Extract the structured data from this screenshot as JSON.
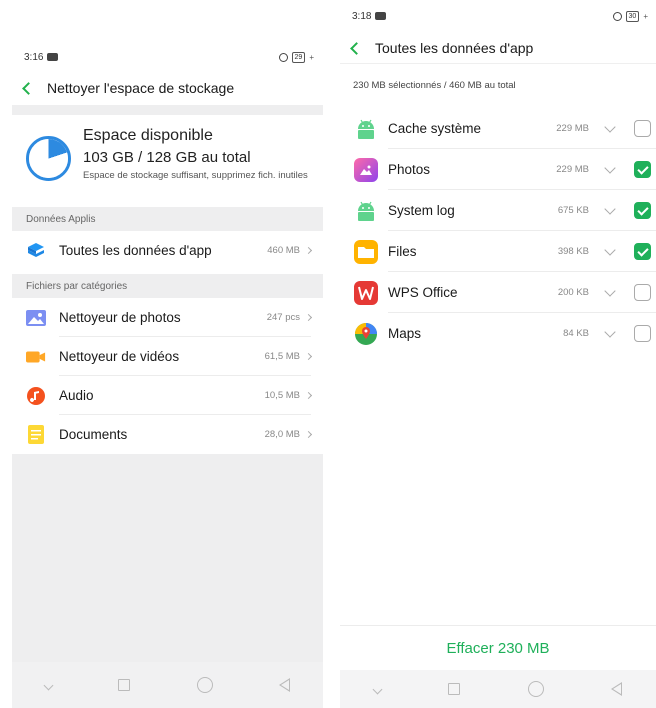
{
  "left": {
    "status": {
      "time": "3:16",
      "battery": "29"
    },
    "header": {
      "title": "Nettoyer l'espace de stockage"
    },
    "storage": {
      "title": "Espace disponible",
      "amount": "103 GB / 128 GB au total",
      "note": "Espace de stockage suffisant, supprimez fich. inutiles",
      "used_fraction": 0.2
    },
    "sections": {
      "apps": "Données Applis",
      "categories": "Fichiers par catégories"
    },
    "app_row": {
      "label": "Toutes les données d'app",
      "value": "460 MB"
    },
    "category_rows": [
      {
        "label": "Nettoyeur de photos",
        "value": "247 pcs",
        "icon": "photo-icon"
      },
      {
        "label": "Nettoyeur de vidéos",
        "value": "61,5 MB",
        "icon": "video-icon"
      },
      {
        "label": "Audio",
        "value": "10,5 MB",
        "icon": "audio-icon"
      },
      {
        "label": "Documents",
        "value": "28,0 MB",
        "icon": "document-icon"
      }
    ]
  },
  "right": {
    "status": {
      "time": "3:18",
      "battery": "30"
    },
    "header": {
      "title": "Toutes les données d'app"
    },
    "selection_summary": "230 MB sélectionnés / 460 MB au total",
    "apps": [
      {
        "name": "Cache système",
        "size": "229 MB",
        "checked": false,
        "icon": "android-icon"
      },
      {
        "name": "Photos",
        "size": "229 MB",
        "checked": true,
        "icon": "photos-app-icon"
      },
      {
        "name": "System log",
        "size": "675 KB",
        "checked": true,
        "icon": "android-icon"
      },
      {
        "name": "Files",
        "size": "398 KB",
        "checked": true,
        "icon": "files-app-icon"
      },
      {
        "name": "WPS Office",
        "size": "200 KB",
        "checked": false,
        "icon": "wps-office-icon"
      },
      {
        "name": "Maps",
        "size": "84 KB",
        "checked": false,
        "icon": "maps-icon"
      }
    ],
    "action": "Effacer 230 MB"
  },
  "colors": {
    "accent": "#1fb05a",
    "back_arrow": "#22b14c",
    "pie": "#2d8ae0"
  }
}
